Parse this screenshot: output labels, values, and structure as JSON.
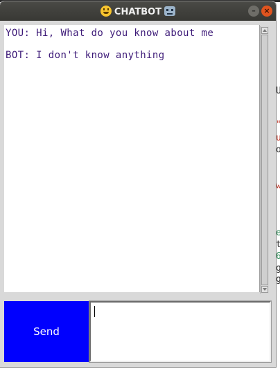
{
  "window": {
    "title": "CHATBOT",
    "title_left_icon": "grinning-face-icon",
    "title_right_icon": "robot-face-icon",
    "minimize_glyph": "–",
    "close_glyph": "×"
  },
  "chat": {
    "messages": [
      {
        "text": "YOU: Hi, What do you know about me"
      },
      {
        "text": "BOT: I don't know anything"
      }
    ],
    "text_color": "#3d1a78"
  },
  "send_button": {
    "label": "Send",
    "color": "#0000fe"
  },
  "message_input": {
    "value": ""
  },
  "background_fragments": [
    {
      "text": "U",
      "color": "#333333"
    },
    {
      "text": "\"",
      "color": "#c0392b"
    },
    {
      "text": "u",
      "color": "#c0392b"
    },
    {
      "text": "o",
      "color": "#333333"
    },
    {
      "text": "w",
      "color": "#c0392b"
    },
    {
      "text": "e",
      "color": "#2e8b57"
    },
    {
      "text": "t",
      "color": "#333333"
    },
    {
      "text": "6",
      "color": "#2e8b57"
    },
    {
      "text": "g",
      "color": "#333333"
    },
    {
      "text": "g",
      "color": "#333333"
    }
  ]
}
